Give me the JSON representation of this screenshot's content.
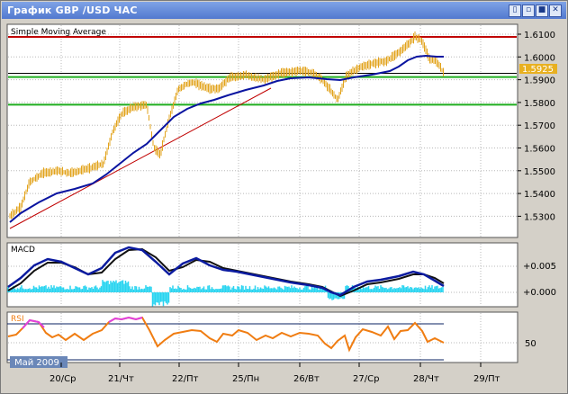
{
  "window": {
    "title": "График GBP /USD  ЧАС",
    "buttons": [
      "▯",
      "▫",
      "■",
      "✕"
    ]
  },
  "main_panel": {
    "indicator_label": "Simple Moving Average",
    "price_labels": [
      "1.6100",
      "1.6000",
      "1.5900",
      "1.5800",
      "1.5700",
      "1.5600",
      "1.5500",
      "1.5400",
      "1.5300"
    ],
    "current_price": "1.5925",
    "red_line_level": 1.6088,
    "green_line_levels": [
      1.5912,
      1.579
    ],
    "black_line_level": 1.5928
  },
  "macd_panel": {
    "label": "MACD",
    "scale_labels": [
      "+0.005",
      "+0.000"
    ]
  },
  "rsi_panel": {
    "label": "RSI",
    "scale_label": "50"
  },
  "month_label": "Май 2009",
  "x_axis": {
    "day_labels": [
      "20/Ср",
      "21/Чт",
      "22/Пт",
      "25/Пн",
      "26/Вт",
      "27/Ср",
      "28/Чт",
      "29/Пт"
    ]
  },
  "colors": {
    "candles": "#e2a31c",
    "sma": "#0a14a0",
    "red_line": "#c00000",
    "green_line": "#1fae1f",
    "macd_main": "#0b1ba0",
    "macd_signal": "#111111",
    "macd_hist": "#29d4f0",
    "rsi": "#f07d12",
    "rsi_high": "#e040e0",
    "price_tag": "#e8b020"
  }
}
